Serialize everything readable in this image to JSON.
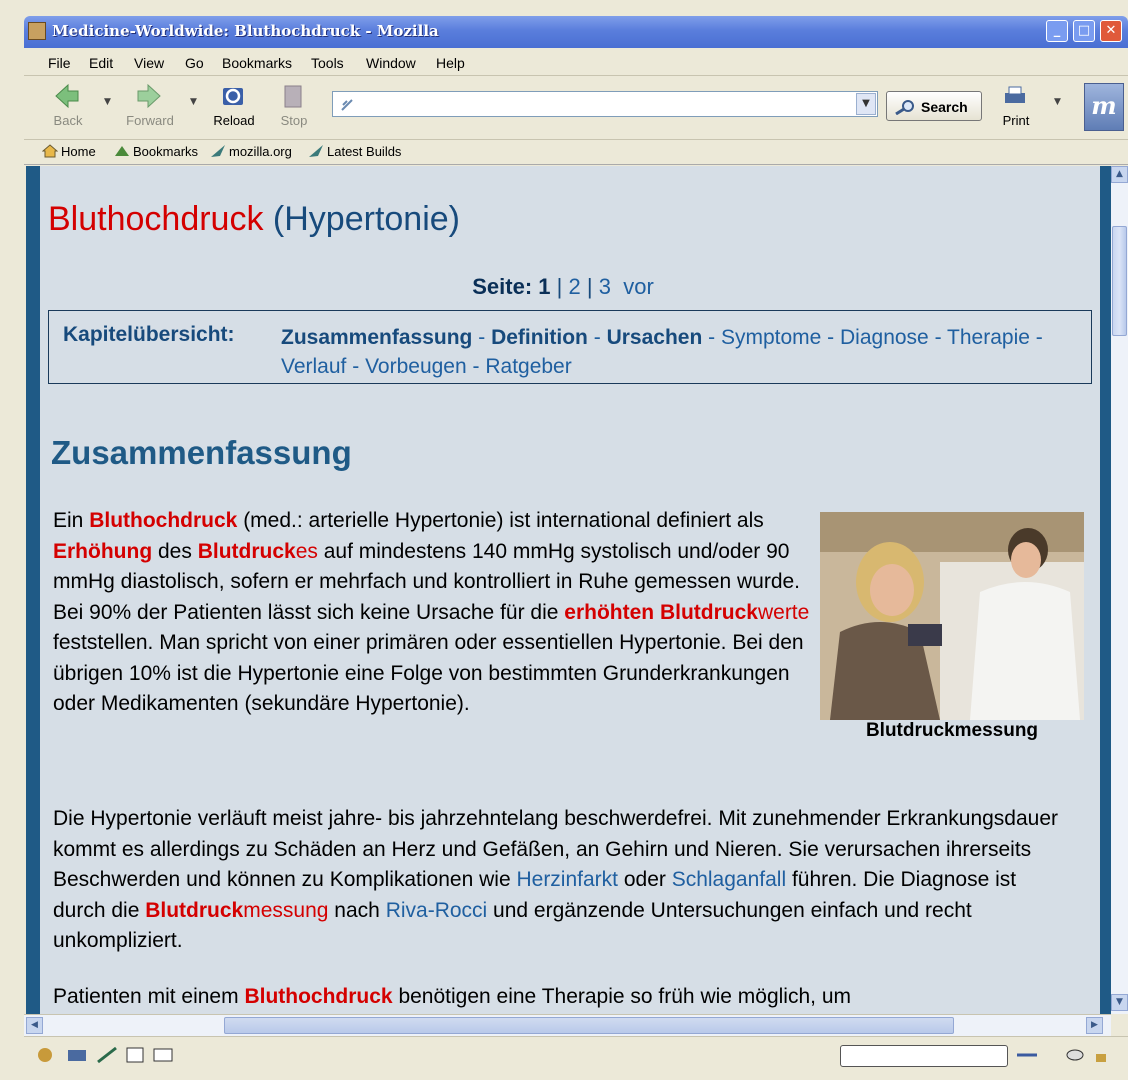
{
  "window": {
    "title": "Medicine-Worldwide: Bluthochdruck - Mozilla",
    "min_glyph": "_",
    "max_glyph": "□",
    "close_glyph": "✕"
  },
  "menu": [
    "File",
    "Edit",
    "View",
    "Go",
    "Bookmarks",
    "Tools",
    "Window",
    "Help"
  ],
  "toolbar": {
    "back": "Back",
    "forward": "Forward",
    "reload": "Reload",
    "stop": "Stop",
    "url_value": "",
    "search": "Search",
    "print": "Print"
  },
  "bookmarks_bar": [
    "Home",
    "Bookmarks",
    "mozilla.org",
    "Latest Builds"
  ],
  "page": {
    "title_main": "Bluthochdruck",
    "title_paren": "(Hypertonie)",
    "pager": {
      "label": "Seite:",
      "current": "1",
      "sep1": "|",
      "p2": "2",
      "sep2": "|",
      "p3": "3",
      "next": "vor"
    },
    "chapter": {
      "label": "Kapitelübersicht:",
      "links": [
        "Zusammenfassung",
        "Definition",
        "Ursachen",
        "Symptome",
        "Diagnose",
        "Therapie",
        "Verlauf",
        "Vorbeugen",
        "Ratgeber"
      ]
    },
    "heading": "Zusammenfassung",
    "image_caption": "Blutdruckmessung",
    "p1": {
      "t0": "Ein ",
      "k1": "Bluthochdruck",
      "t1": " (med.: arterielle Hypertonie) ist international definiert als ",
      "k2": "Erhöhung",
      "t2": " des ",
      "k3": "Blutdruck",
      "k3b": "es",
      "t3": " auf mindestens 140 mmHg systolisch und/oder 90 mmHg diastolisch, sofern er mehrfach und kontrolliert in Ruhe gemessen wurde. Bei 90% der Patienten lässt sich keine Ursache für die ",
      "k4": "erhöhten Blutdruck",
      "k4b": "werte",
      "t4": " feststellen. Man spricht von einer primären oder essentiellen Hypertonie. Bei den übrigen 10% ist die Hypertonie eine Folge von bestimmten Grunderkrankungen oder Medikamenten (sekundäre Hypertonie)."
    },
    "p2": {
      "t0": "Die Hypertonie verläuft meist jahre- bis jahrzehntelang beschwerdefrei. Mit zunehmender Erkrankungsdauer kommt es allerdings zu Schäden an Herz und Gefäßen, an Gehirn und Nieren. Sie verursachen ihrerseits Beschwerden und können zu Komplikationen wie ",
      "l1": "Herzinfarkt",
      "t1": " oder ",
      "l2": "Schlaganfall",
      "t2": " führen. Die Diagnose ist durch die ",
      "k1": "Blutdruck",
      "k1b": "messung",
      "t3": " nach ",
      "l3": "Riva-Rocci",
      "t4": " und ergänzende Untersuchungen einfach und recht unkompliziert."
    },
    "p3": {
      "t0": "Patienten mit einem ",
      "k1": "Bluthochdruck",
      "t1": " benötigen eine Therapie so früh wie möglich, um"
    }
  },
  "colors": {
    "keyword_red": "#d40000",
    "nav_blue": "#174a7c",
    "link_blue": "#1f5fa0",
    "page_bg": "#d6dee6",
    "stripe": "#1f5a86"
  }
}
